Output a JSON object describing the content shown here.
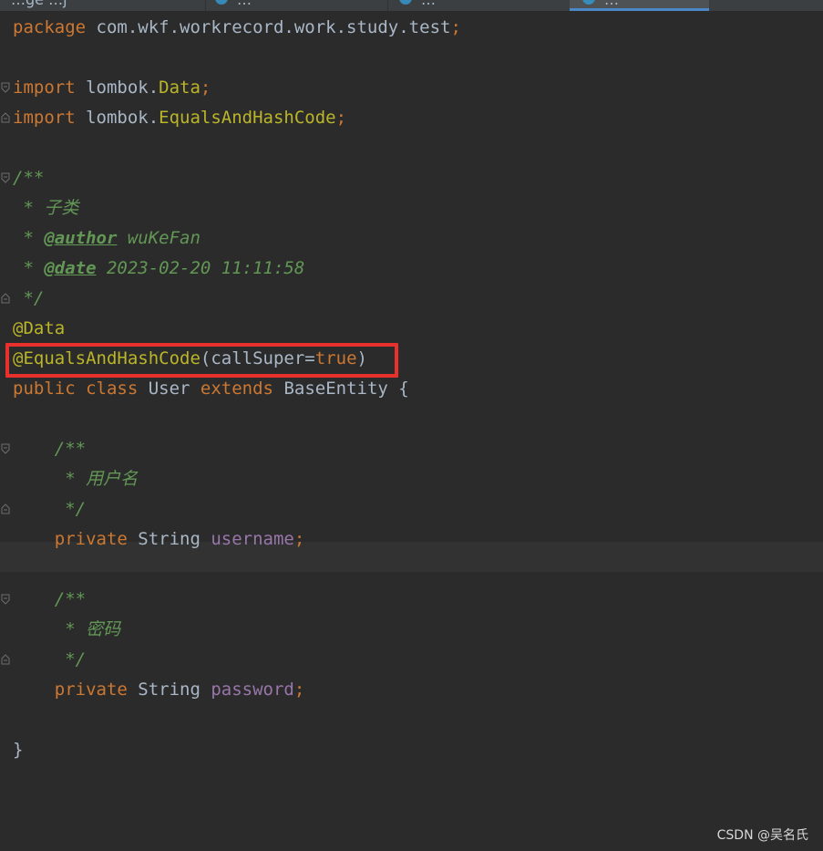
{
  "tabs": [
    {
      "label": "…ge      …j"
    },
    {
      "label": "…"
    },
    {
      "label": "…"
    },
    {
      "label": "…"
    }
  ],
  "code": {
    "package_kw": "package",
    "package_name": " com.wkf.workrecord.work.study.test",
    "semicolon": ";",
    "import_kw": "import",
    "import1_pkg": " lombok.",
    "import1_cls": "Data",
    "import2_pkg": " lombok.",
    "import2_cls": "EqualsAndHashCode",
    "javadoc_open": "/**",
    "doc_line1": " * 子类",
    "doc_star": " * ",
    "author_tag": "@author",
    "author_val": " wuKeFan",
    "date_tag": "@date",
    "date_val": " 2023-02-20 11:11:58",
    "javadoc_close": " */",
    "ann_data": "@Data",
    "ann_equals": "@EqualsAndHashCode",
    "ann_args_open": "(callSuper=",
    "ann_true": "true",
    "ann_args_close": ")",
    "public_kw": "public",
    "class_kw": " class",
    "class_name": " User ",
    "extends_kw": "extends",
    "base_name": " BaseEntity {",
    "field1_doc_open": "    /**",
    "field1_doc": "     * 用户名",
    "field1_doc_close": "     */",
    "private_kw": "    private",
    "string_type": " String ",
    "field1_name": "username",
    "field2_doc_open": "    /**",
    "field2_doc": "     * 密码",
    "field2_doc_close": "     */",
    "field2_name": "password",
    "close_brace": "}"
  },
  "watermark": "CSDN @吴名氏",
  "colors": {
    "background": "#2b2b2b",
    "keyword": "#cc7832",
    "annotation": "#bbb529",
    "field": "#9876aa",
    "comment": "#629755",
    "text": "#a9b7c6",
    "highlight_border": "#e8302c"
  }
}
